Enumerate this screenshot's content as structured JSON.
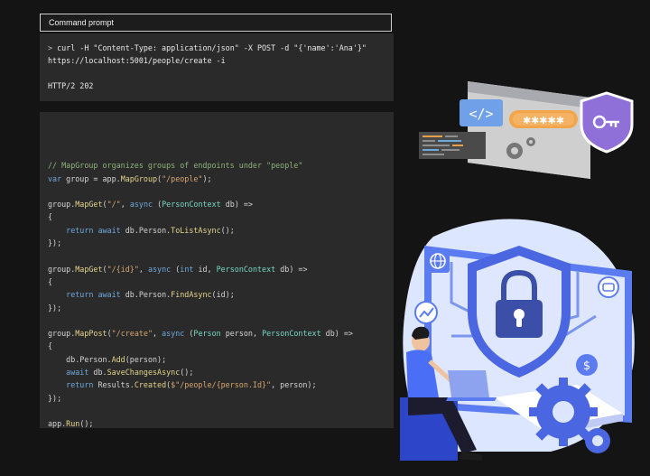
{
  "terminal": {
    "title": "Command prompt",
    "prompt_symbol": ">",
    "command_line1": " curl -H \"Content-Type: application/json\" -X POST -d \"{'name':'Ana'}\"",
    "command_line2": "https://localhost:5001/people/create -i",
    "response": "HTTP/2 202"
  },
  "code": {
    "lines": [
      [],
      [
        {
          "t": "// MapGroup organizes groups of endpoints under \"people\"",
          "c": "comment"
        }
      ],
      [
        {
          "t": "var",
          "c": "kw"
        },
        {
          "t": " group = app.",
          "c": "plain"
        },
        {
          "t": "MapGroup",
          "c": "fn"
        },
        {
          "t": "(",
          "c": "plain"
        },
        {
          "t": "\"/people\"",
          "c": "str"
        },
        {
          "t": ");",
          "c": "plain"
        }
      ],
      [],
      [
        {
          "t": "group.",
          "c": "plain"
        },
        {
          "t": "MapGet",
          "c": "fn"
        },
        {
          "t": "(",
          "c": "plain"
        },
        {
          "t": "\"/\"",
          "c": "str"
        },
        {
          "t": ", ",
          "c": "plain"
        },
        {
          "t": "async",
          "c": "kw"
        },
        {
          "t": " (",
          "c": "plain"
        },
        {
          "t": "PersonContext",
          "c": "type"
        },
        {
          "t": " db) =>",
          "c": "plain"
        }
      ],
      [
        {
          "t": "{",
          "c": "plain"
        }
      ],
      [
        {
          "t": "    return await",
          "c": "kw"
        },
        {
          "t": " db.Person.",
          "c": "plain"
        },
        {
          "t": "ToListAsync",
          "c": "fn"
        },
        {
          "t": "();",
          "c": "plain"
        }
      ],
      [
        {
          "t": "});",
          "c": "plain"
        }
      ],
      [],
      [
        {
          "t": "group.",
          "c": "plain"
        },
        {
          "t": "MapGet",
          "c": "fn"
        },
        {
          "t": "(",
          "c": "plain"
        },
        {
          "t": "\"/{id}\"",
          "c": "str"
        },
        {
          "t": ", ",
          "c": "plain"
        },
        {
          "t": "async",
          "c": "kw"
        },
        {
          "t": " (",
          "c": "plain"
        },
        {
          "t": "int",
          "c": "kw"
        },
        {
          "t": " id, ",
          "c": "plain"
        },
        {
          "t": "PersonContext",
          "c": "type"
        },
        {
          "t": " db) =>",
          "c": "plain"
        }
      ],
      [
        {
          "t": "{",
          "c": "plain"
        }
      ],
      [
        {
          "t": "    return await",
          "c": "kw"
        },
        {
          "t": " db.Person.",
          "c": "plain"
        },
        {
          "t": "FindAsync",
          "c": "fn"
        },
        {
          "t": "(id);",
          "c": "plain"
        }
      ],
      [
        {
          "t": "});",
          "c": "plain"
        }
      ],
      [],
      [
        {
          "t": "group.",
          "c": "plain"
        },
        {
          "t": "MapPost",
          "c": "fn"
        },
        {
          "t": "(",
          "c": "plain"
        },
        {
          "t": "\"/create\"",
          "c": "str"
        },
        {
          "t": ", ",
          "c": "plain"
        },
        {
          "t": "async",
          "c": "kw"
        },
        {
          "t": " (",
          "c": "plain"
        },
        {
          "t": "Person",
          "c": "type"
        },
        {
          "t": " person, ",
          "c": "plain"
        },
        {
          "t": "PersonContext",
          "c": "type"
        },
        {
          "t": " db) =>",
          "c": "plain"
        }
      ],
      [
        {
          "t": "{",
          "c": "plain"
        }
      ],
      [
        {
          "t": "    db.Person.",
          "c": "plain"
        },
        {
          "t": "Add",
          "c": "fn"
        },
        {
          "t": "(person);",
          "c": "plain"
        }
      ],
      [
        {
          "t": "    await",
          "c": "kw"
        },
        {
          "t": " db.",
          "c": "plain"
        },
        {
          "t": "SaveChangesAsync",
          "c": "fn"
        },
        {
          "t": "();",
          "c": "plain"
        }
      ],
      [
        {
          "t": "    return",
          "c": "kw"
        },
        {
          "t": " Results.",
          "c": "plain"
        },
        {
          "t": "Created",
          "c": "fn"
        },
        {
          "t": "(",
          "c": "plain"
        },
        {
          "t": "$\"/people/{person.Id}\"",
          "c": "str"
        },
        {
          "t": ", person);",
          "c": "plain"
        }
      ],
      [
        {
          "t": "});",
          "c": "plain"
        }
      ],
      [],
      [
        {
          "t": "app.",
          "c": "plain"
        },
        {
          "t": "Run",
          "c": "fn"
        },
        {
          "t": "();",
          "c": "plain"
        }
      ]
    ]
  },
  "colors": {
    "background": "#141414",
    "panel": "#2a2a2a",
    "comment": "#8fb37a",
    "keyword": "#6fa8dc",
    "string": "#d7a66f",
    "type": "#76d7c4",
    "method": "#e5d48b",
    "accent_blue": "#5b7cf0",
    "accent_purple": "#8f6fd8",
    "accent_orange": "#f2a54a"
  },
  "illustration": {
    "code_tag_icon": "code-brackets-icon",
    "password_field_icon": "password-stars-icon",
    "password_stars": "✱✱✱✱✱",
    "shield_key_icon": "shield-key-icon",
    "gear_icon": "gear-icon",
    "globe_icon": "globe-icon",
    "lock_icon": "padlock-icon",
    "dollar_icon": "dollar-icon",
    "chart_icon": "trend-chart-icon",
    "person": "developer-with-laptop"
  }
}
